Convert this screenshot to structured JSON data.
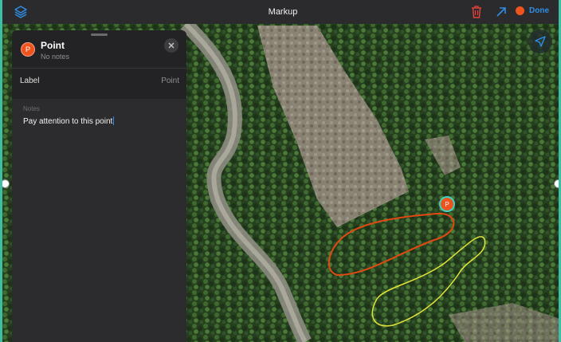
{
  "topbar": {
    "title": "Markup",
    "done_label": "Done",
    "icons": {
      "layers": "layers-icon",
      "trash": "trash-icon",
      "share": "share-arrow-icon",
      "recording": "record-dot-icon"
    }
  },
  "panel": {
    "title": "Point",
    "subtitle": "No notes",
    "badge_letter": "P",
    "label_row": {
      "key": "Label",
      "value": "Point"
    },
    "notes": {
      "caption": "Notes",
      "text": "Pay attention to this point"
    }
  },
  "map": {
    "point_marker_letter": "P",
    "overlay_colors": {
      "orange_loop": "#e04a12",
      "yellow_loop": "#e2e43a",
      "marker_ring": "#3fd1c3"
    }
  },
  "colors": {
    "accent": "#2f8ee6",
    "recording": "#f0541e",
    "frame": "#3dbfa3",
    "trash": "#e5423b"
  }
}
